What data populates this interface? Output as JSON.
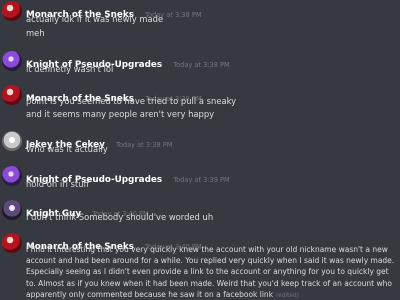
{
  "messages": [
    {
      "username": "Monarch of the Sneks",
      "timestamp": "Today at 3:38 PM",
      "avatar": "red-avatar",
      "lines": [
        "actually idk if it was newly made",
        "meh"
      ]
    },
    {
      "username": "Knight of Pseudo-Upgrades",
      "timestamp": "Today at 3:38 PM",
      "avatar": "purple-avatar",
      "lines": [
        "it definetly wasn't lol"
      ]
    },
    {
      "username": "Monarch of the Sneks",
      "timestamp": "Today at 3:38 PM",
      "avatar": "red-avatar",
      "lines": [
        "point is you seemed to have tried to pull a sneaky",
        "and it seems many people aren't very happy"
      ]
    },
    {
      "username": "Jekey the Cekey",
      "timestamp": "Today at 3:38 PM",
      "avatar": "grey-avatar",
      "lines": [
        "Who was it actually"
      ]
    },
    {
      "username": "Knight of Pseudo-Upgrades",
      "timestamp": "Today at 3:39 PM",
      "avatar": "purple-avatar",
      "lines": [
        "hold on irl stuff"
      ]
    },
    {
      "username": "Knight Guy",
      "timestamp": "Today at 3:40 PM",
      "avatar": "dark-avatar",
      "lines": [
        "I don't think Somebody should've worded uh"
      ]
    },
    {
      "username": "Monarch of the Sneks",
      "timestamp": "Today at 3:40 PM",
      "avatar": "red-avatar",
      "paragraph": "I find it interesting that you very quickly knew the account with your old nickname wasn't a new account and had been around for a while. You replied very quickly when I said it was newly made. Especially seeing as I didn't even provide a link to the account or anything for you to quickly get to. Almost as if you knew when it had been made. Weird that you'd keep track of an account who apparently only commented because he saw it on a facebook link",
      "edited_label": "(edited)"
    }
  ]
}
